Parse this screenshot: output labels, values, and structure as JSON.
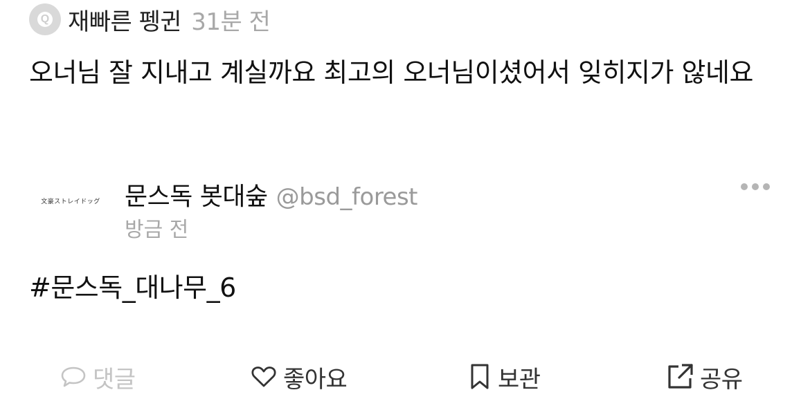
{
  "quote": {
    "avatar_letter": "Q",
    "author": "재빠른 펭귄",
    "time": "31분 전",
    "text": "오너님 잘 지내고 계실까요 최고의 오너님이셨어서 잊히지가 않네요"
  },
  "embed": {
    "logo_text": "文豪ストレイドッグ",
    "name": "문스독 봇대숲",
    "handle": "@bsd_forest",
    "time": "방금 전",
    "hashtag": "#문스독_대나무_6"
  },
  "actions": {
    "comment": "댓글",
    "like": "좋아요",
    "bookmark": "보관",
    "share": "공유"
  },
  "icons": {
    "comment": "speech-bubble-icon",
    "like": "heart-icon",
    "bookmark": "bookmark-icon",
    "share": "share-external-icon",
    "more": "more-dots-icon"
  },
  "colors": {
    "text": "#111111",
    "muted": "#a8a8a8",
    "disabled": "#c4c4c4",
    "avatar_bg": "#d9d9d9"
  }
}
